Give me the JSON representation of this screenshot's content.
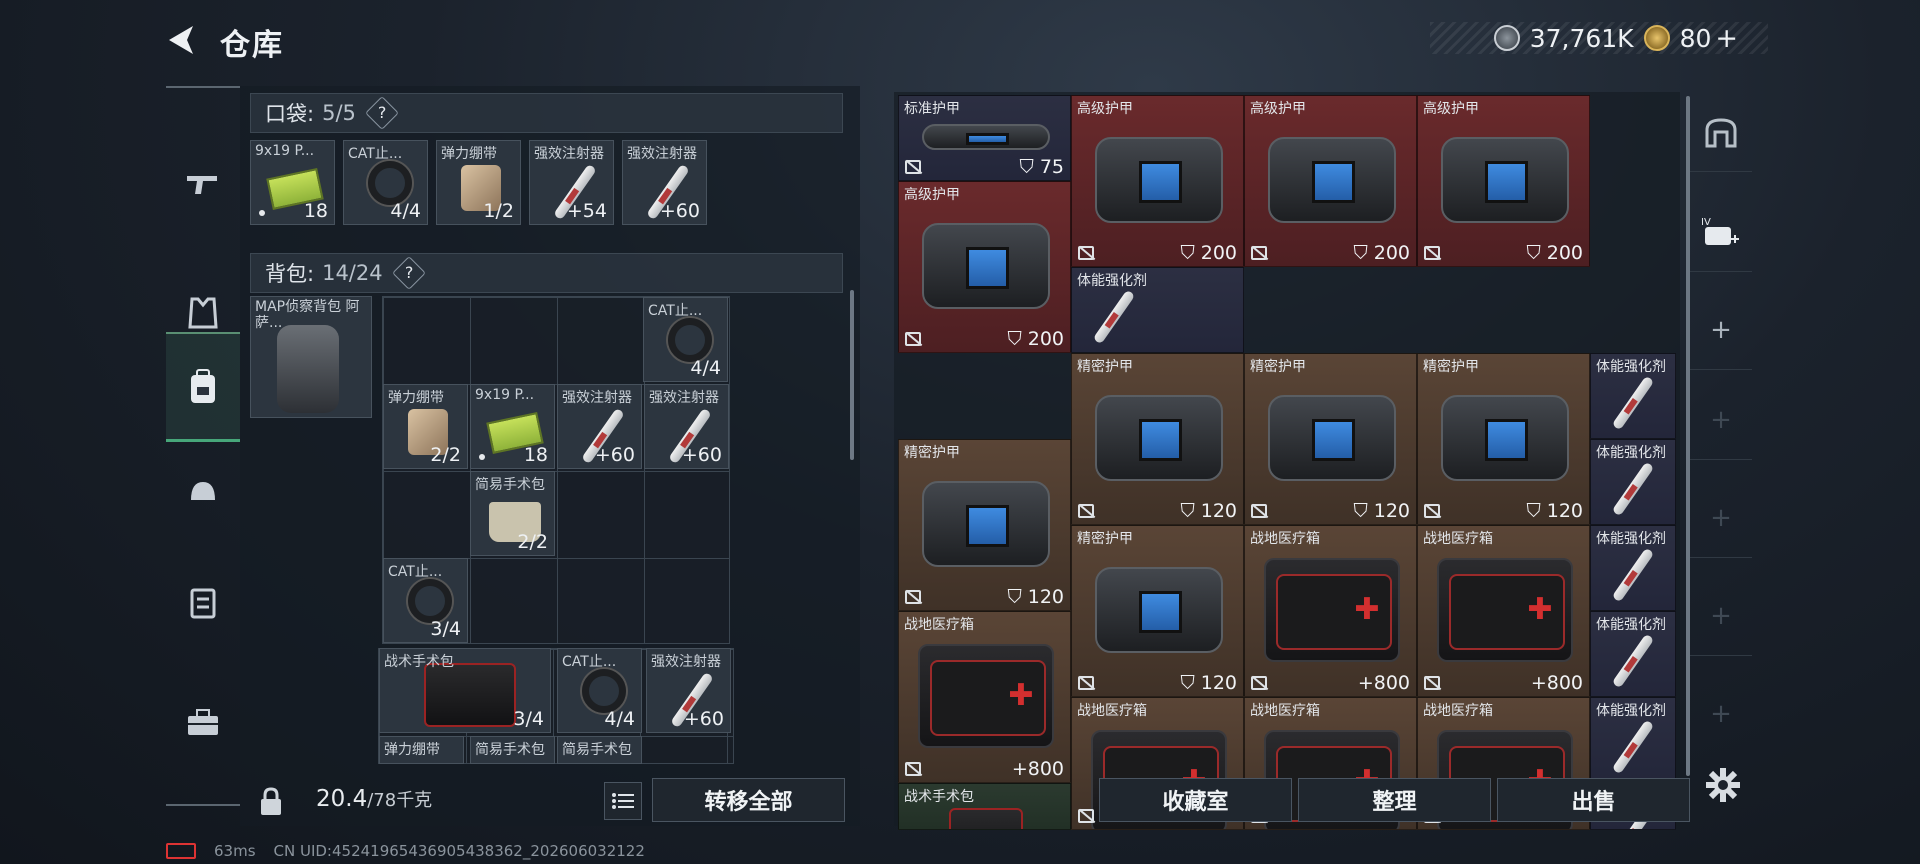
{
  "header": {
    "title": "仓库",
    "currency": "37,761K",
    "premium": "80",
    "premium_plus": "+"
  },
  "left_nav": {
    "items": [
      "weapon",
      "armor",
      "backpack",
      "helmet",
      "vest",
      "case"
    ]
  },
  "pocket": {
    "label": "口袋:",
    "count": "5/5",
    "help": "?",
    "items": [
      {
        "name": "9x19 P...",
        "qty": "18"
      },
      {
        "name": "CAT止...",
        "qty": "4/4"
      },
      {
        "name": "弹力绷带",
        "qty": "1/2"
      },
      {
        "name": "强效注射器",
        "qty": "+54"
      },
      {
        "name": "强效注射器",
        "qty": "+60"
      }
    ]
  },
  "backpack": {
    "label": "背包:",
    "count": "14/24",
    "help": "?",
    "bag_name": "MAP侦察背包 阿萨...",
    "items": [
      {
        "name": "CAT止...",
        "qty": "4/4"
      },
      {
        "name": "弹力绷带",
        "qty": "2/2"
      },
      {
        "name": "9x19 P...",
        "qty": "18"
      },
      {
        "name": "强效注射器",
        "qty": "+60"
      },
      {
        "name": "强效注射器",
        "qty": "+60"
      },
      {
        "name": "简易手术包",
        "qty": "2/2"
      },
      {
        "name": "CAT止...",
        "qty": "3/4"
      },
      {
        "name": "战术手术包",
        "qty": "3/4"
      },
      {
        "name": "CAT止...",
        "qty": "4/4"
      },
      {
        "name": "强效注射器",
        "qty": "+60"
      },
      {
        "name": "弹力绷带",
        "qty": ""
      },
      {
        "name": "简易手术包",
        "qty": ""
      },
      {
        "name": "简易手术包",
        "qty": ""
      }
    ]
  },
  "storage": {
    "cells": [
      {
        "name": "标准护甲",
        "val": "75"
      },
      {
        "name": "高级护甲",
        "val": "200"
      },
      {
        "name": "高级护甲",
        "val": "200"
      },
      {
        "name": "高级护甲",
        "val": "200"
      },
      {
        "name": "高级护甲",
        "val": "200"
      },
      {
        "name": "体能强化剂",
        "val": ""
      },
      {
        "name": "精密护甲",
        "val": "120"
      },
      {
        "name": "精密护甲",
        "val": "120"
      },
      {
        "name": "精密护甲",
        "val": "120"
      },
      {
        "name": "体能强化剂",
        "val": ""
      },
      {
        "name": "精密护甲",
        "val": "120"
      },
      {
        "name": "体能强化剂",
        "val": ""
      },
      {
        "name": "精密护甲",
        "val": "120"
      },
      {
        "name": "战地医疗箱",
        "val": "+800"
      },
      {
        "name": "战地医疗箱",
        "val": "+800"
      },
      {
        "name": "体能强化剂",
        "val": ""
      },
      {
        "name": "战地医疗箱",
        "val": "+800"
      },
      {
        "name": "体能强化剂",
        "val": ""
      },
      {
        "name": "战地医疗箱",
        "val": ""
      },
      {
        "name": "战地医疗箱",
        "val": ""
      },
      {
        "name": "战地医疗箱",
        "val": ""
      },
      {
        "name": "体能强化剂",
        "val": ""
      },
      {
        "name": "战术手术包",
        "val": ""
      },
      {
        "name": "体能强化剂",
        "val": ""
      }
    ]
  },
  "footer": {
    "weight": "20.4",
    "weight_max": "/78千克",
    "transfer_all": "转移全部",
    "collection": "收藏室",
    "organize": "整理",
    "sell": "出售"
  },
  "status": {
    "ping": "63ms",
    "uid": "CN UID:4524196543690543​8362_202606032122"
  }
}
